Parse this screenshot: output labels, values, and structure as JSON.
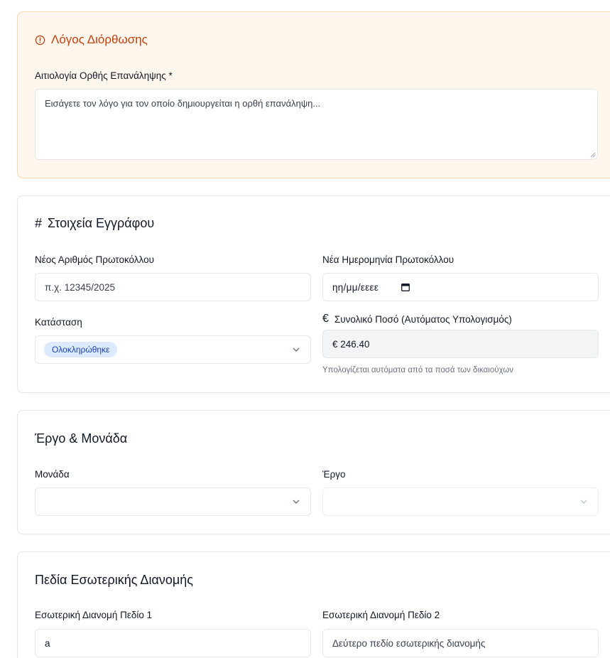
{
  "correction": {
    "title": "Λόγος Διόρθωσης",
    "reason_label": "Αιτιολογία Ορθής Επανάληψης *",
    "reason_placeholder": "Εισάγετε τον λόγο για τον οποίο δημιουργείται η ορθή επανάληψη..."
  },
  "document": {
    "title": "Στοιχεία Εγγράφου",
    "protocol_number_label": "Νέος Αριθμός Πρωτοκόλλου",
    "protocol_number_placeholder": "π.χ. 12345/2025",
    "protocol_date_label": "Νέα Ημερομηνία Πρωτοκόλλου",
    "protocol_date_placeholder": "ηη/μμ/εεεε",
    "status_label": "Κατάσταση",
    "status_value": "Ολοκληρώθηκε",
    "total_label": "Συνολικό Ποσό (Αυτόματος Υπολογισμός)",
    "total_icon": "euro-icon",
    "total_value": "€ 246.40",
    "total_hint": "Υπολογίζεται αυτόματα από τα ποσά των δικαιούχων"
  },
  "project": {
    "title": "Έργο & Μονάδα",
    "unit_label": "Μονάδα",
    "project_label": "Έργο"
  },
  "distribution": {
    "title": "Πεδία Εσωτερικής Διανομής",
    "field1_label": "Εσωτερική Διανομή Πεδίο 1",
    "field1_value": "a",
    "field2_label": "Εσωτερική Διανομή Πεδίο 2",
    "field2_placeholder": "Δεύτερο πεδίο εσωτερικής διανομής"
  },
  "colors": {
    "warning_accent": "#c2410c",
    "badge_bg": "#dbeafe",
    "badge_text": "#1e40af"
  }
}
